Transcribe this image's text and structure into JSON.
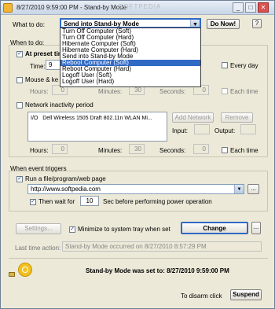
{
  "window": {
    "title": "8/27/2010 9:59:00 PM - Stand-by Mode",
    "watermark": "SOFTPEDIA"
  },
  "titlebar_buttons": {
    "minimize": "_",
    "maximize": "□",
    "close": "✕"
  },
  "what_to_do": {
    "label": "What to do:",
    "selected": "Send into Stand-by Mode",
    "do_now": "Do Now!",
    "help": "?",
    "options": [
      {
        "label": "Turn Off Computer (Soft)",
        "selected": false
      },
      {
        "label": "Turn Off Computer (Hard)",
        "selected": false
      },
      {
        "label": "Hibernate Computer (Soft)",
        "selected": false
      },
      {
        "label": "Hibernate Computer (Hard)",
        "selected": false
      },
      {
        "label": "Send into Stand-by Mode",
        "selected": false
      },
      {
        "label": "Reboot Computer (Soft)",
        "selected": true
      },
      {
        "label": "Reboot Computer (Hard)",
        "selected": false
      },
      {
        "label": "Logoff User (Soft)",
        "selected": false
      },
      {
        "label": "Logoff User (Hard)",
        "selected": false
      }
    ]
  },
  "when_to_do": {
    "label": "When to do:",
    "preset": {
      "label": "At preset tim",
      "checked": true,
      "time_label": "Time:",
      "time_value": "9",
      "every_day": "Every day"
    },
    "mouse": {
      "label": "Mouse & ke",
      "checked": false,
      "hours_label": "Hours:",
      "hours": "0",
      "minutes_label": "Minutes:",
      "minutes": "30",
      "seconds_label": "Seconds:",
      "seconds": "0",
      "each_time": "Each time"
    },
    "network": {
      "label": "Network inactivity period",
      "checked": false,
      "adapter_prefix": "I/O",
      "adapter": "Dell Wireless 1505 Draft 802.11n WLAN Mi...",
      "add_network": "Add Network",
      "remove": "Remove",
      "input_label": "Input:",
      "output_label": "Output:",
      "hours_label": "Hours:",
      "hours": "0",
      "minutes_label": "Minutes:",
      "minutes": "30",
      "seconds_label": "Seconds:",
      "seconds": "0",
      "each_time": "Each time"
    }
  },
  "event_triggers": {
    "label": "When event triggers",
    "run": {
      "label": "Run a file/program/web page",
      "checked": true,
      "url": "http://www.softpedia.com",
      "browse": "..."
    },
    "wait": {
      "then_wait": "Then wait for",
      "checked": true,
      "value": "10",
      "suffix": "Sec  before performing power operation"
    }
  },
  "actions": {
    "settings": "Settings...",
    "minimize_tray": "Minimize to system tray when set",
    "minimize_checked": true,
    "change": "Change",
    "change_more": "..."
  },
  "last_action": {
    "label": "Last time action:",
    "value": "Stand-by Mode occurred on 8/27/2010 8:57:29 PM"
  },
  "status": {
    "text": "Stand-by Mode was set to: 8/27/2010 9:59:00 PM",
    "disarm": "To disarm click",
    "suspend": "Suspend"
  }
}
